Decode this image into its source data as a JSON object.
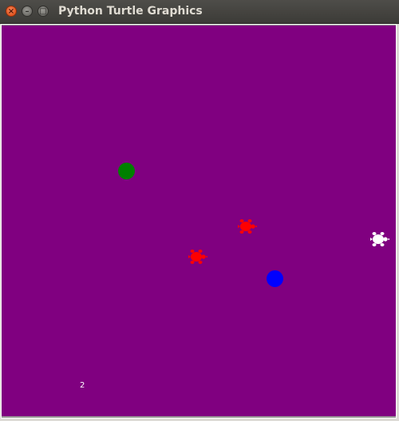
{
  "window": {
    "title": "Python Turtle Graphics",
    "close_glyph": "×",
    "minimize_glyph": "–",
    "maximize_glyph": "□"
  },
  "canvas": {
    "background_color": "#800080"
  },
  "game": {
    "score": "2",
    "goals": [
      {
        "name": "green-goal-dot",
        "color": "#008000"
      },
      {
        "name": "blue-goal-dot",
        "color": "#0000ff"
      }
    ],
    "enemies": [
      {
        "name": "red-turtle-enemy-1",
        "color": "#ff0000",
        "icon": "turtle-icon"
      },
      {
        "name": "red-turtle-enemy-2",
        "color": "#ff0000",
        "icon": "turtle-icon"
      }
    ],
    "player": {
      "name": "white-turtle-player",
      "color": "#ffffff",
      "icon": "turtle-icon"
    }
  }
}
